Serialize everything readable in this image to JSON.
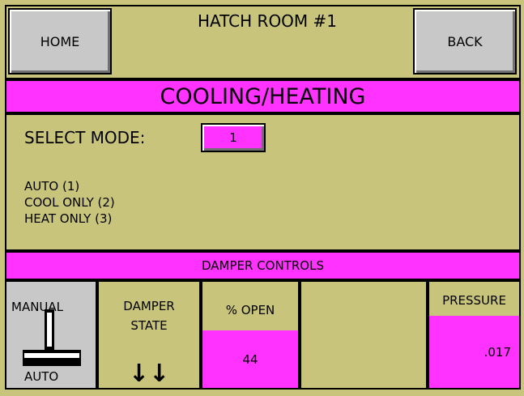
{
  "header": {
    "home_label": "HOME",
    "title": "HATCH ROOM #1",
    "back_label": "BACK"
  },
  "mode_section": {
    "banner": "COOLING/HEATING",
    "select_label": "SELECT MODE:",
    "mode_value": "1",
    "options": [
      "AUTO (1)",
      "COOL ONLY (2)",
      "HEAT ONLY (3)"
    ]
  },
  "damper": {
    "banner": "DAMPER CONTROLS",
    "switch_top_label": "MANUAL",
    "switch_bottom_label": "AUTO",
    "state_label_line1": "DAMPER",
    "state_label_line2": "STATE",
    "state_icon": "double-down-arrow-icon",
    "state_glyph": "↓↓",
    "percent_open_label": "% OPEN",
    "percent_open_value": "44",
    "pressure_label": "PRESSURE",
    "pressure_value": ".017"
  },
  "colors": {
    "background": "#c8c47c",
    "accent_magenta": "#ff32ff",
    "button_gray": "#c8c8c8"
  }
}
